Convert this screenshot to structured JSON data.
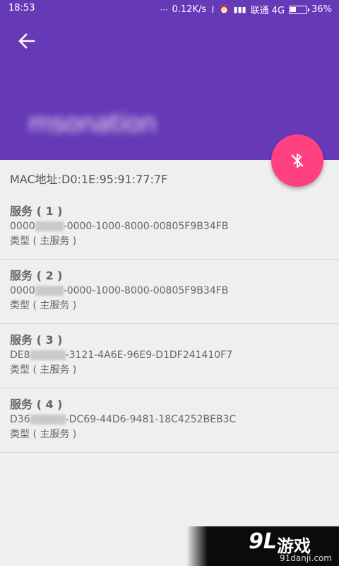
{
  "status_bar": {
    "time": "18:53",
    "net_speed": "0.12K/s",
    "carrier": "联通 4G",
    "battery": "36%",
    "battery_level": 0.36
  },
  "header": {
    "device_name": "msonation",
    "color": "#6639b7",
    "back_icon": "arrow-left-icon"
  },
  "fab": {
    "icon": "bluetooth-disabled-icon",
    "color": "#ff4081"
  },
  "device": {
    "mac_label": "MAC地址:D0:1E:95:91:77:7F"
  },
  "services": [
    {
      "title": "服务 ( 1 )",
      "uuid_prefix": "0000",
      "uuid_suffix": "-0000-1000-8000-00805F9B34FB",
      "type": "类型 ( 主服务 )"
    },
    {
      "title": "服务 ( 2 )",
      "uuid_prefix": "0000",
      "uuid_suffix": "-0000-1000-8000-00805F9B34FB",
      "type": "类型 ( 主服务 )"
    },
    {
      "title": "服务 ( 3 )",
      "uuid_prefix": "DE8",
      "uuid_suffix": "-3121-4A6E-96E9-D1DF241410F7",
      "type": "类型 ( 主服务 )"
    },
    {
      "title": "服务 ( 4 )",
      "uuid_prefix": "D36",
      "uuid_suffix": "-DC69-44D6-9481-18C4252BEB3C",
      "type": "类型 ( 主服务 )"
    }
  ],
  "watermark": {
    "logo": "9L",
    "text": "游戏",
    "url": "91danji.com"
  }
}
